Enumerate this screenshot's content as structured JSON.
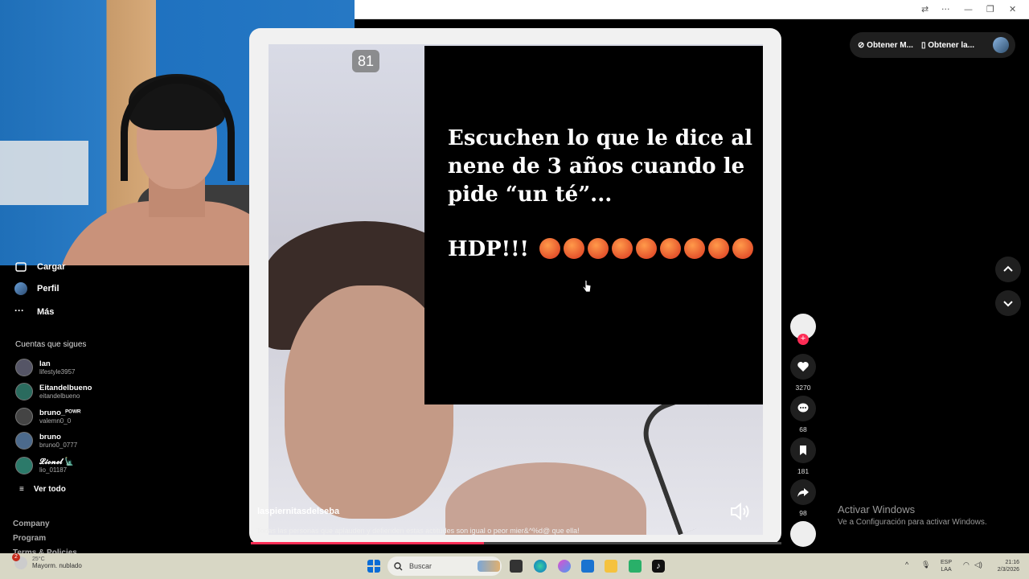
{
  "window": {
    "translate_icon": "translate-icon",
    "more_label": "···",
    "minimize_label": "—",
    "restore_label": "❐",
    "close_label": "✕"
  },
  "sidebar": {
    "upload_label": "Cargar",
    "profile_label": "Perfil",
    "more_label": "Más",
    "following_title": "Cuentas que sigues",
    "following": [
      {
        "name": "Ian",
        "handle": "lifestyle3957"
      },
      {
        "name": "Eitandelbueno",
        "handle": "eitandelbueno"
      },
      {
        "name": "bruno_ᴾᴼᵂᴿ",
        "handle": "valemn0_0"
      },
      {
        "name": "bruno",
        "handle": "bruno0_0777"
      },
      {
        "name": "𝓛𝓲𝓸𝓷𝓮𝓵 🗽",
        "handle": "lio_01187"
      }
    ],
    "see_all_label": "Ver todo",
    "footer": [
      "Company",
      "Program",
      "Terms & Policies"
    ]
  },
  "video": {
    "counter_tag": "81",
    "overlay_text": "Escuchen lo que le dice al\nnene de 3 años cuando le\npide “un té”...",
    "overlay_shout": "HDP!!!",
    "emoji_count": 9,
    "author": "laspiernitasdelseba",
    "description": "Todas las personas que aplauden y defienden estas actitudes son igual o peor mier&^%d@ que ella!",
    "progress": 0.44
  },
  "top_buttons": {
    "get_coins": "Obtener M...",
    "get_app": "Obtener la..."
  },
  "actions": {
    "likes": "3270",
    "comments": "68",
    "saves": "181",
    "shares": "98"
  },
  "watermark": {
    "title": "Activar Windows",
    "subtitle": "Ve a Configuración para activar Windows."
  },
  "taskbar": {
    "weather_temp": "25°C",
    "weather_desc": "Mayorm. nublado",
    "weather_badge": "2",
    "search_placeholder": "Buscar",
    "lang_top": "ESP",
    "lang_bottom": "LAA",
    "time": "21:16",
    "date": "2/3/2026"
  },
  "colors": {
    "accent": "#fe2c55",
    "background": "#000000",
    "taskbar": "#d8d7c5"
  }
}
